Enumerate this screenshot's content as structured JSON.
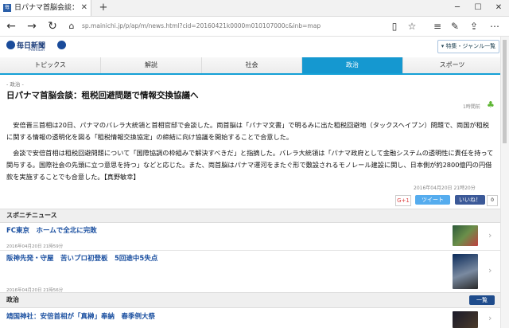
{
  "browser": {
    "tab_title": "日パナマ首脳会談：租税",
    "tab_favicon": "毎",
    "url": "sp.mainichi.jp/p/ap/m/news.html?cid=20160421k0000m010107000c&inb=map",
    "icons": [
      "back-icon",
      "forward-icon",
      "refresh-icon",
      "home-icon",
      "reading-view-icon",
      "favorite-star-icon",
      "hub-icon",
      "notes-icon",
      "share-icon",
      "more-icon"
    ]
  },
  "site": {
    "logo_text": "毎日新聞",
    "logo_sub": "Premium",
    "genre_button": "▾ 特集・ジャンル一覧",
    "nav_tabs": [
      "トピックス",
      "解説",
      "社会",
      "政治",
      "スポーツ"
    ],
    "active_tab": "政治",
    "accent": "#1598d0"
  },
  "article": {
    "kicker": "- 政治 -",
    "headline": "日パナマ首脳会談：租税回避問題で情報交換協議へ",
    "ago": "1時間前",
    "para1": "安倍晋三首相は20日、パナマのバレラ大統領と首相官邸で会談した。両首脳は「パナマ文書」で明るみに出た租税回避地（タックスヘイブン）問題で、両国が租税に関する情報の透明化を図る「租税情報交換協定」の締結に向け協議を開始することで合意した。",
    "para2": "会談で安倍首相は租税回避問題について「国際協調の枠組みで解決すべきだ」と指摘した。バレラ大統領は「パナマ政府として金融システムの透明性に責任を持って関与する。国際社会の先頭に立つ意思を持つ」などと応じた。また、両首脳はパナマ運河をまたぐ形で敷設されるモノレール建設に関し、日本側が約2800億円の円借款を実施することでも合意した。【真野敏幸】",
    "dateline": "2016年04月20日 21時20分",
    "share": {
      "gplus": "G+1",
      "tweet": "ツイート",
      "fb_like": "いいね！",
      "fb_count": "0"
    }
  },
  "sections": [
    {
      "label": "スポニチニュース",
      "items": [
        {
          "title": "FC東京　ホームで全北に完敗",
          "date": "2016年04月20日 21時59分"
        },
        {
          "title": "阪神先発・守屋　苦いプロ初登板　5回途中5失点",
          "date": "2016年04月20日 21時56分"
        }
      ]
    },
    {
      "label": "政治",
      "more": "一覧",
      "items": [
        {
          "title": "靖国神社：安倍首相が「真榊」奉納　春季例大祭",
          "date": ""
        }
      ]
    }
  ]
}
